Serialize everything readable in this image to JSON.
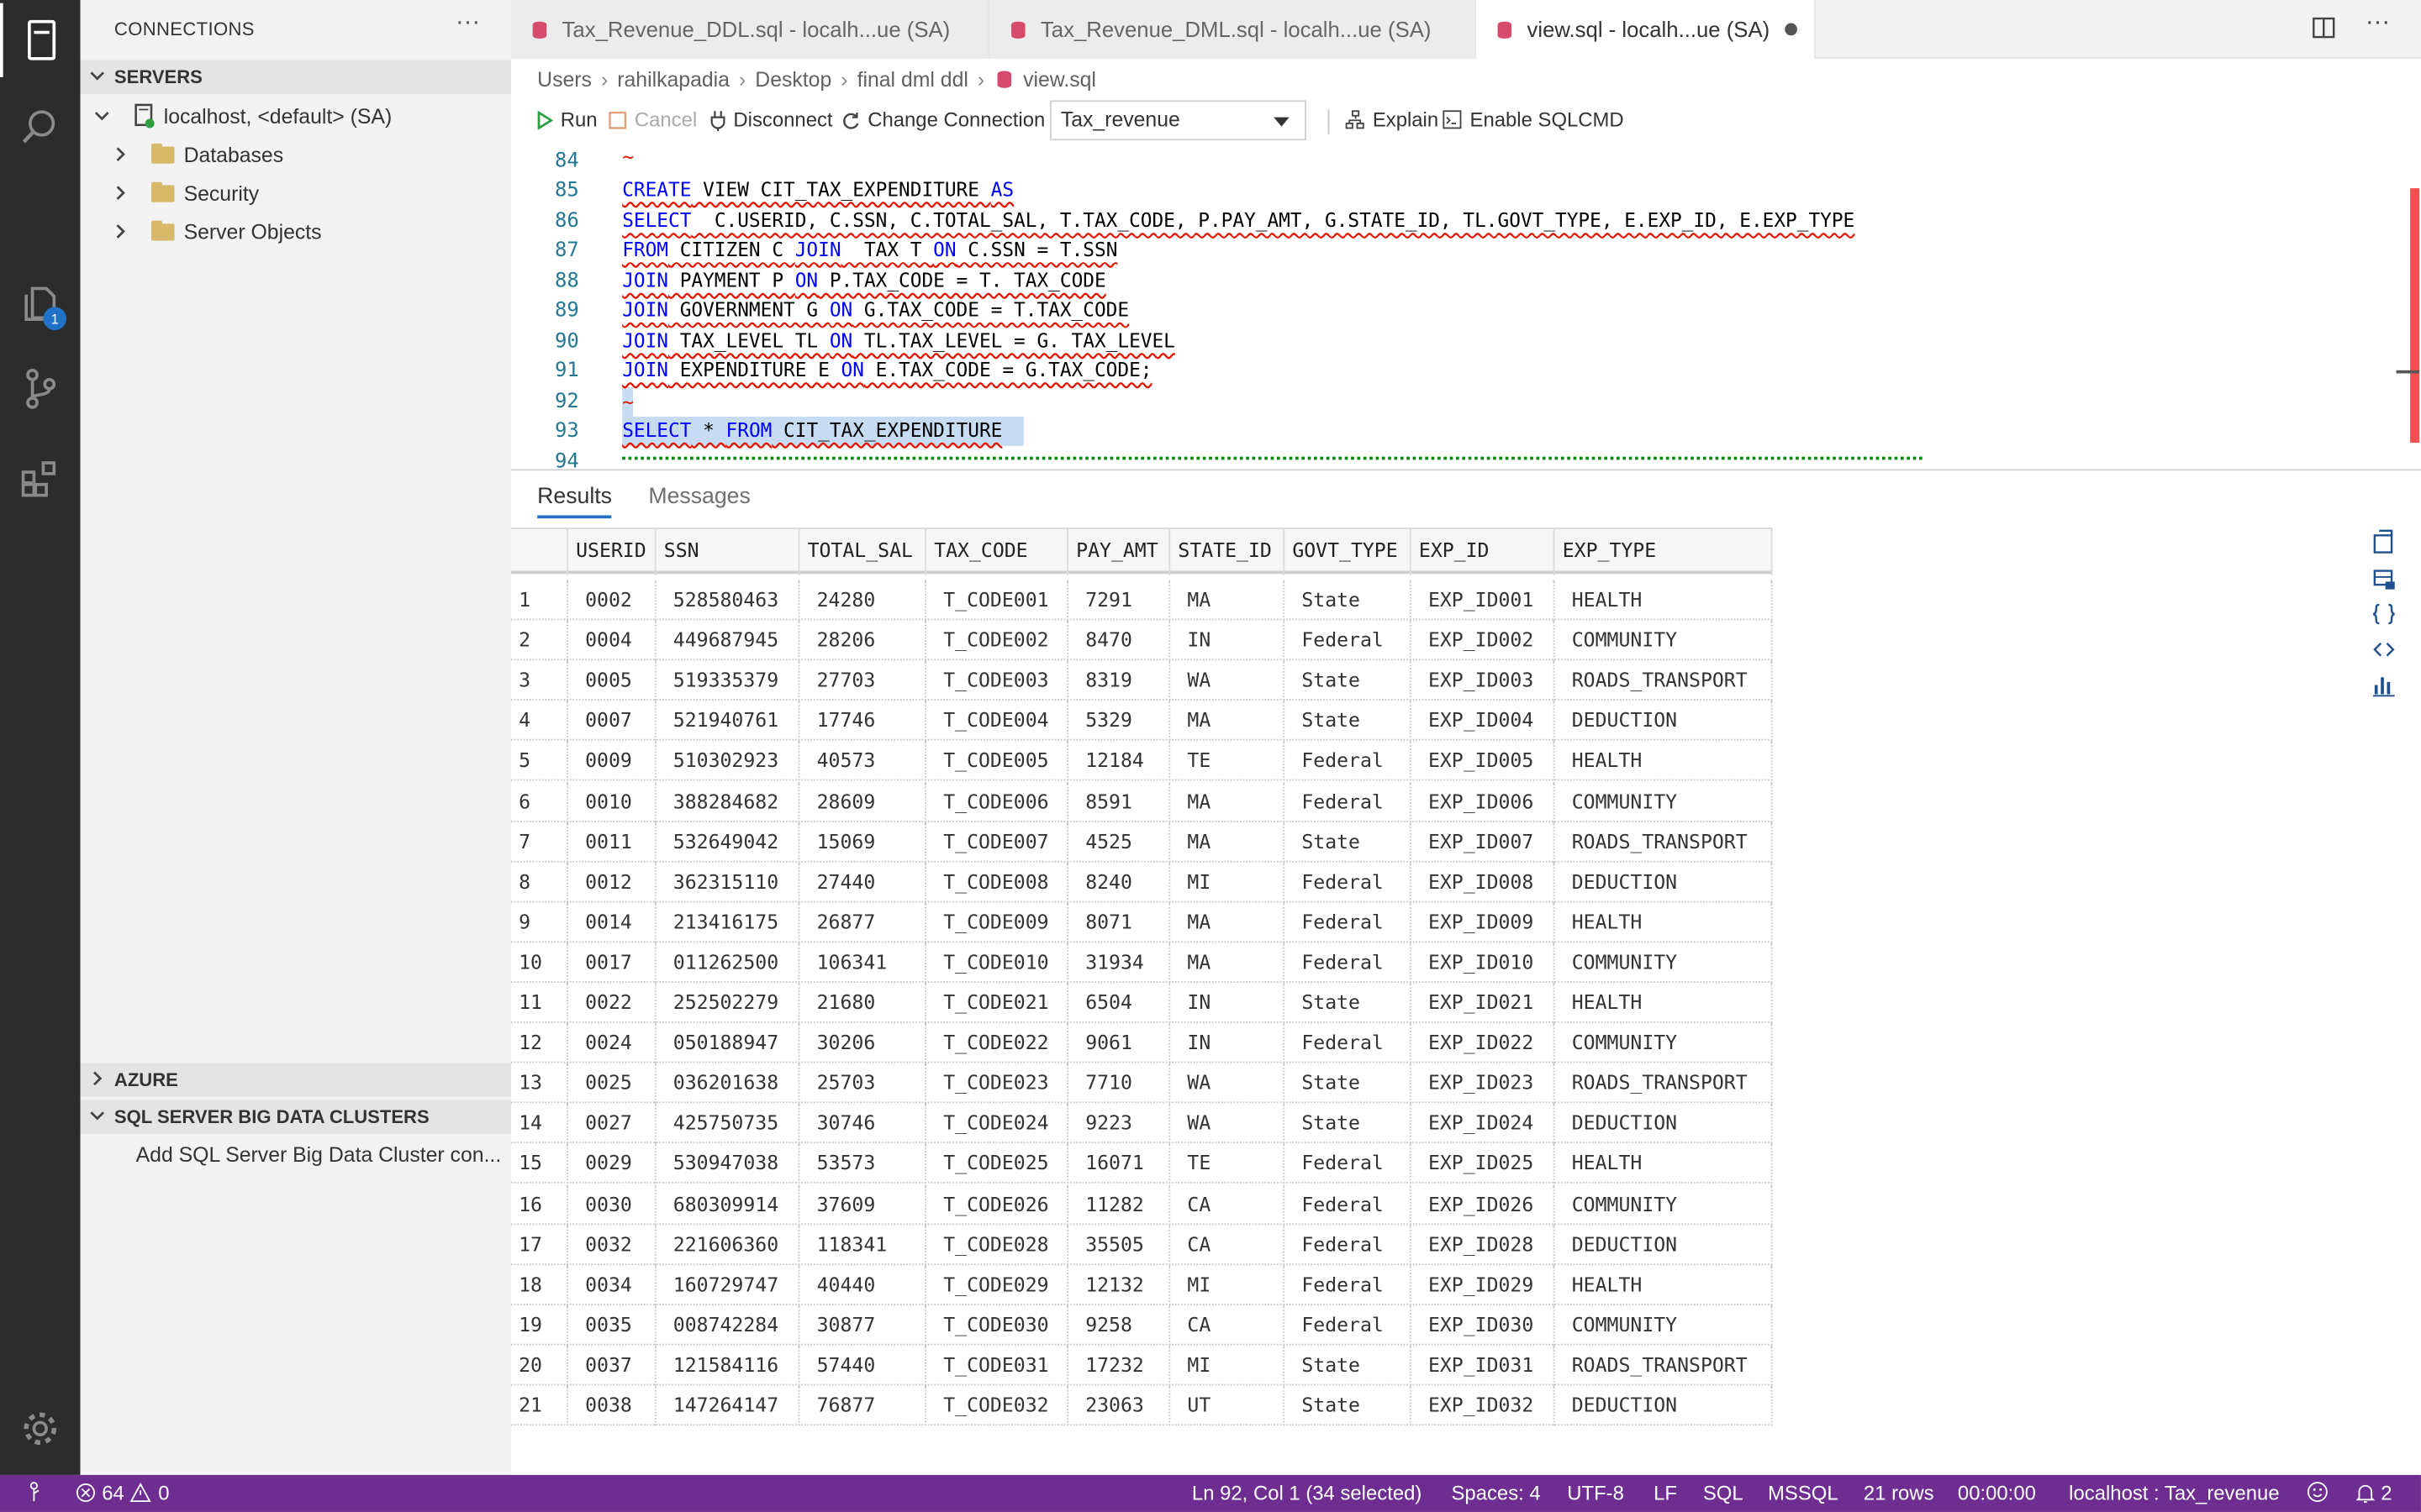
{
  "sidebar": {
    "title": "CONNECTIONS",
    "servers_header": "SERVERS",
    "server_label": "localhost, <default> (SA)",
    "folders": [
      "Databases",
      "Security",
      "Server Objects"
    ],
    "azure_header": "AZURE",
    "bdc_header": "SQL SERVER BIG DATA CLUSTERS",
    "bdc_item": "Add SQL Server Big Data Cluster con..."
  },
  "activity": {
    "explorer_badge": "1"
  },
  "tabs": [
    {
      "label": "Tax_Revenue_DDL.sql - localh...ue (SA)"
    },
    {
      "label": "Tax_Revenue_DML.sql - localh...ue (SA)"
    },
    {
      "label": "view.sql - localh...ue (SA)"
    }
  ],
  "breadcrumb": [
    "Users",
    "rahilkapadia",
    "Desktop",
    "final dml ddl",
    "view.sql"
  ],
  "toolbar": {
    "run": "Run",
    "cancel": "Cancel",
    "disconnect": "Disconnect",
    "change_connection": "Change Connection",
    "database": "Tax_revenue",
    "explain": "Explain",
    "sqlcmd": "Enable SQLCMD"
  },
  "editor": {
    "line_numbers": [
      "84",
      "85",
      "86",
      "87",
      "88",
      "89",
      "90",
      "91",
      "92",
      "93",
      "94"
    ],
    "lines": {
      "l85": [
        [
          "kw",
          "CREATE"
        ],
        [
          "t",
          " VIEW CIT_TAX_EXPENDITURE "
        ],
        [
          "kw",
          "AS"
        ]
      ],
      "l86": [
        [
          "kw",
          "SELECT"
        ],
        [
          "t",
          "  C.USERID, C.SSN, C.TOTAL_SAL, T.TAX_CODE, P.PAY_AMT, G.STATE_ID, TL.GOVT_TYPE, E.EXP_ID, E.EXP_TYPE"
        ]
      ],
      "l87": [
        [
          "kw",
          "FROM"
        ],
        [
          "t",
          " CITIZEN C "
        ],
        [
          "kw",
          "JOIN"
        ],
        [
          "t",
          "  TAX T "
        ],
        [
          "kw",
          "ON"
        ],
        [
          "t",
          " C.SSN = T.SSN"
        ]
      ],
      "l88": [
        [
          "kw",
          "JOIN"
        ],
        [
          "t",
          " PAYMENT P "
        ],
        [
          "kw",
          "ON"
        ],
        [
          "t",
          " P.TAX_CODE = T. TAX_CODE"
        ]
      ],
      "l89": [
        [
          "kw",
          "JOIN"
        ],
        [
          "t",
          " GOVERNMENT G "
        ],
        [
          "kw",
          "ON"
        ],
        [
          "t",
          " G.TAX_CODE = T.TAX_CODE"
        ]
      ],
      "l90": [
        [
          "kw",
          "JOIN"
        ],
        [
          "t",
          " TAX_LEVEL TL "
        ],
        [
          "kw",
          "ON"
        ],
        [
          "t",
          " TL.TAX_LEVEL = G. TAX_LEVEL"
        ]
      ],
      "l91": [
        [
          "kw",
          "JOIN"
        ],
        [
          "t",
          " EXPENDITURE E "
        ],
        [
          "kw",
          "ON"
        ],
        [
          "t",
          " E.TAX_CODE = G.TAX_CODE;"
        ]
      ],
      "l93": [
        [
          "kw",
          "SELECT"
        ],
        [
          "t",
          " * "
        ],
        [
          "kw",
          "FROM"
        ],
        [
          "t",
          " CIT_TAX_EXPENDITURE"
        ]
      ]
    }
  },
  "results": {
    "tabs": [
      "Results",
      "Messages"
    ],
    "columns": [
      "USERID",
      "SSN",
      "TOTAL_SAL",
      "TAX_CODE",
      "PAY_AMT",
      "STATE_ID",
      "GOVT_TYPE",
      "EXP_ID",
      "EXP_TYPE"
    ],
    "rows": [
      [
        "1",
        "0002",
        "528580463",
        "24280",
        "T_CODE001",
        "7291",
        "MA",
        "State",
        "EXP_ID001",
        "HEALTH"
      ],
      [
        "2",
        "0004",
        "449687945",
        "28206",
        "T_CODE002",
        "8470",
        "IN",
        "Federal",
        "EXP_ID002",
        "COMMUNITY"
      ],
      [
        "3",
        "0005",
        "519335379",
        "27703",
        "T_CODE003",
        "8319",
        "WA",
        "State",
        "EXP_ID003",
        "ROADS_TRANSPORT"
      ],
      [
        "4",
        "0007",
        "521940761",
        "17746",
        "T_CODE004",
        "5329",
        "MA",
        "State",
        "EXP_ID004",
        "DEDUCTION"
      ],
      [
        "5",
        "0009",
        "510302923",
        "40573",
        "T_CODE005",
        "12184",
        "TE",
        "Federal",
        "EXP_ID005",
        "HEALTH"
      ],
      [
        "6",
        "0010",
        "388284682",
        "28609",
        "T_CODE006",
        "8591",
        "MA",
        "Federal",
        "EXP_ID006",
        "COMMUNITY"
      ],
      [
        "7",
        "0011",
        "532649042",
        "15069",
        "T_CODE007",
        "4525",
        "MA",
        "State",
        "EXP_ID007",
        "ROADS_TRANSPORT"
      ],
      [
        "8",
        "0012",
        "362315110",
        "27440",
        "T_CODE008",
        "8240",
        "MI",
        "Federal",
        "EXP_ID008",
        "DEDUCTION"
      ],
      [
        "9",
        "0014",
        "213416175",
        "26877",
        "T_CODE009",
        "8071",
        "MA",
        "Federal",
        "EXP_ID009",
        "HEALTH"
      ],
      [
        "10",
        "0017",
        "011262500",
        "106341",
        "T_CODE010",
        "31934",
        "MA",
        "Federal",
        "EXP_ID010",
        "COMMUNITY"
      ],
      [
        "11",
        "0022",
        "252502279",
        "21680",
        "T_CODE021",
        "6504",
        "IN",
        "State",
        "EXP_ID021",
        "HEALTH"
      ],
      [
        "12",
        "0024",
        "050188947",
        "30206",
        "T_CODE022",
        "9061",
        "IN",
        "Federal",
        "EXP_ID022",
        "COMMUNITY"
      ],
      [
        "13",
        "0025",
        "036201638",
        "25703",
        "T_CODE023",
        "7710",
        "WA",
        "State",
        "EXP_ID023",
        "ROADS_TRANSPORT"
      ],
      [
        "14",
        "0027",
        "425750735",
        "30746",
        "T_CODE024",
        "9223",
        "WA",
        "State",
        "EXP_ID024",
        "DEDUCTION"
      ],
      [
        "15",
        "0029",
        "530947038",
        "53573",
        "T_CODE025",
        "16071",
        "TE",
        "Federal",
        "EXP_ID025",
        "HEALTH"
      ],
      [
        "16",
        "0030",
        "680309914",
        "37609",
        "T_CODE026",
        "11282",
        "CA",
        "Federal",
        "EXP_ID026",
        "COMMUNITY"
      ],
      [
        "17",
        "0032",
        "221606360",
        "118341",
        "T_CODE028",
        "35505",
        "CA",
        "Federal",
        "EXP_ID028",
        "DEDUCTION"
      ],
      [
        "18",
        "0034",
        "160729747",
        "40440",
        "T_CODE029",
        "12132",
        "MI",
        "Federal",
        "EXP_ID029",
        "HEALTH"
      ],
      [
        "19",
        "0035",
        "008742284",
        "30877",
        "T_CODE030",
        "9258",
        "CA",
        "Federal",
        "EXP_ID030",
        "COMMUNITY"
      ],
      [
        "20",
        "0037",
        "121584116",
        "57440",
        "T_CODE031",
        "17232",
        "MI",
        "State",
        "EXP_ID031",
        "ROADS_TRANSPORT"
      ],
      [
        "21",
        "0038",
        "147264147",
        "76877",
        "T_CODE032",
        "23063",
        "UT",
        "State",
        "EXP_ID032",
        "DEDUCTION"
      ]
    ]
  },
  "status": {
    "errors": "64",
    "warnings": "0",
    "position": "Ln 92, Col 1 (34 selected)",
    "spaces": "Spaces: 4",
    "encoding": "UTF-8",
    "eol": "LF",
    "language": "SQL",
    "dialect": "MSSQL",
    "rows": "21 rows",
    "time": "00:00:00",
    "connection": "localhost : Tax_revenue",
    "notifications": "2"
  },
  "colors": {
    "accent": "#1f72c8",
    "status_bar": "#6e2d91",
    "keyword": "#0000ff",
    "error": "#e51400"
  }
}
